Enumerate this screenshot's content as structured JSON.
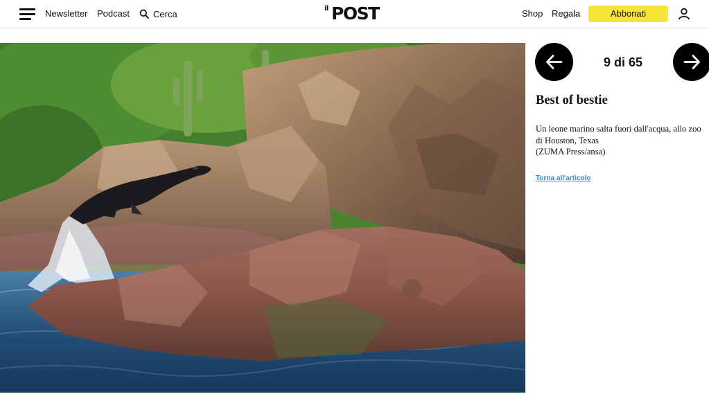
{
  "header": {
    "menu_icon": "hamburger-menu-icon",
    "nav": {
      "newsletter": "Newsletter",
      "podcast": "Podcast"
    },
    "search": {
      "icon": "search-icon",
      "label": "Cerca"
    },
    "logo": {
      "prefix": "il",
      "name": "POST"
    },
    "right_nav": {
      "shop": "Shop",
      "regala": "Regala"
    },
    "subscribe": {
      "label": "Abbonati",
      "color": "#f7e536"
    },
    "user_icon": "user-icon"
  },
  "gallery": {
    "prev_icon": "arrow-left-icon",
    "next_icon": "arrow-right-icon",
    "current": "9",
    "separator": "di",
    "total": "65",
    "title": "Best of bestie",
    "caption_line1": "Un leone marino salta fuori dall'acqua, allo zoo di Houston, Texas",
    "caption_line2": "(ZUMA Press/ansa)",
    "back_link": "Torna all'articolo",
    "link_color": "#3a86c8"
  }
}
